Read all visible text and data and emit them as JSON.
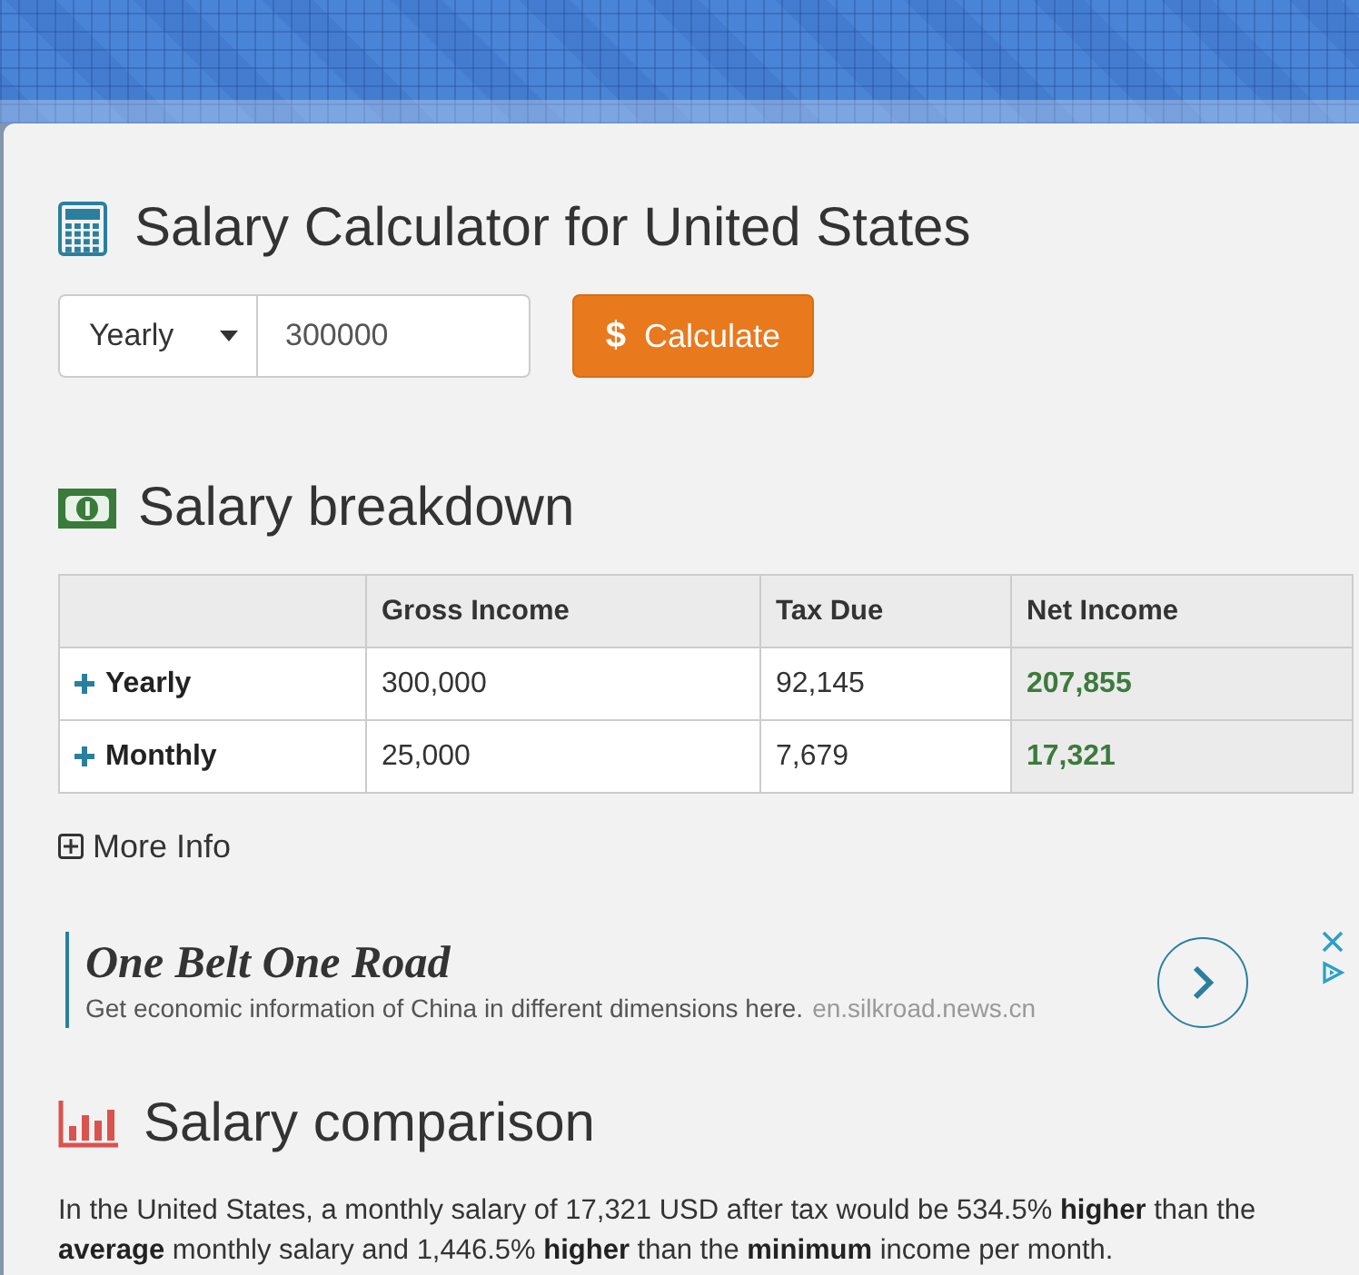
{
  "calculator": {
    "title": "Salary Calculator for United States",
    "period": "Yearly",
    "amount": "300000",
    "button": {
      "symbol": "$",
      "label": "Calculate"
    }
  },
  "breakdown": {
    "title": "Salary breakdown",
    "columns": [
      "Gross Income",
      "Tax Due",
      "Net Income"
    ],
    "rows": [
      {
        "label": "Yearly",
        "expanded": false,
        "cells": [
          "300,000",
          "92,145",
          "207,855"
        ]
      },
      {
        "label": "Monthly",
        "expanded": false,
        "cells": [
          "25,000",
          "7,679",
          "17,321"
        ]
      }
    ],
    "more_info": {
      "label": "More Info",
      "expanded": false
    }
  },
  "ad": {
    "headline": "One Belt One Road",
    "text": "Get economic information of China in different dimensions here.",
    "url": "en.silkroad.news.cn"
  },
  "comparison": {
    "title": "Salary comparison",
    "text": "In the United States, a monthly salary of 17,321 USD after tax would be 534.5% **higher** than the **average** monthly salary and 1,446.5% **higher** than the **minimum** income per month."
  }
}
